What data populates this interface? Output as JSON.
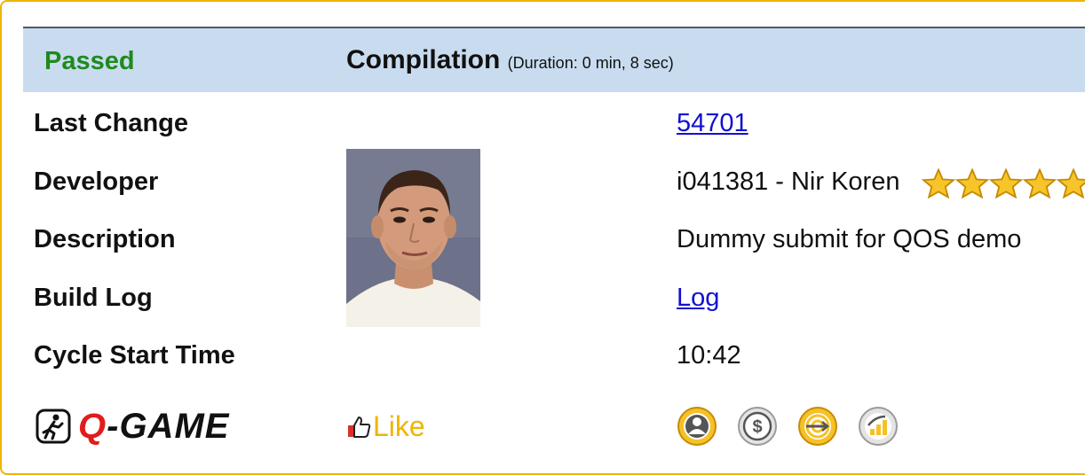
{
  "build": {
    "status": "Passed",
    "stage": "Compilation",
    "duration": "(Duration: 0 min, 8 sec)",
    "colors": {
      "status": "#1e8a1e",
      "header_bg": "#c9dcef",
      "accent": "#f0b400",
      "link": "#1010d0"
    }
  },
  "rows": [
    {
      "label": "Last Change",
      "value": "54701",
      "is_link": true
    },
    {
      "label": "Developer",
      "value": "i041381 - Nir Koren",
      "is_link": false
    },
    {
      "label": "Description",
      "value": "Dummy submit for QOS demo",
      "is_link": false
    },
    {
      "label": "Build Log",
      "value": "Log",
      "is_link": true
    },
    {
      "label": "Cycle Start Time",
      "value": "10:42",
      "is_link": false
    }
  ],
  "developer": {
    "photo_icon": "developer-photo",
    "rating_stars": 5
  },
  "footer": {
    "qgame_logo_q": "Q",
    "qgame_logo_rest": "-GAME",
    "like_label": "Like",
    "badges": [
      "person-badge-icon",
      "dollar-badge-icon",
      "target-badge-icon",
      "growth-badge-icon"
    ]
  }
}
